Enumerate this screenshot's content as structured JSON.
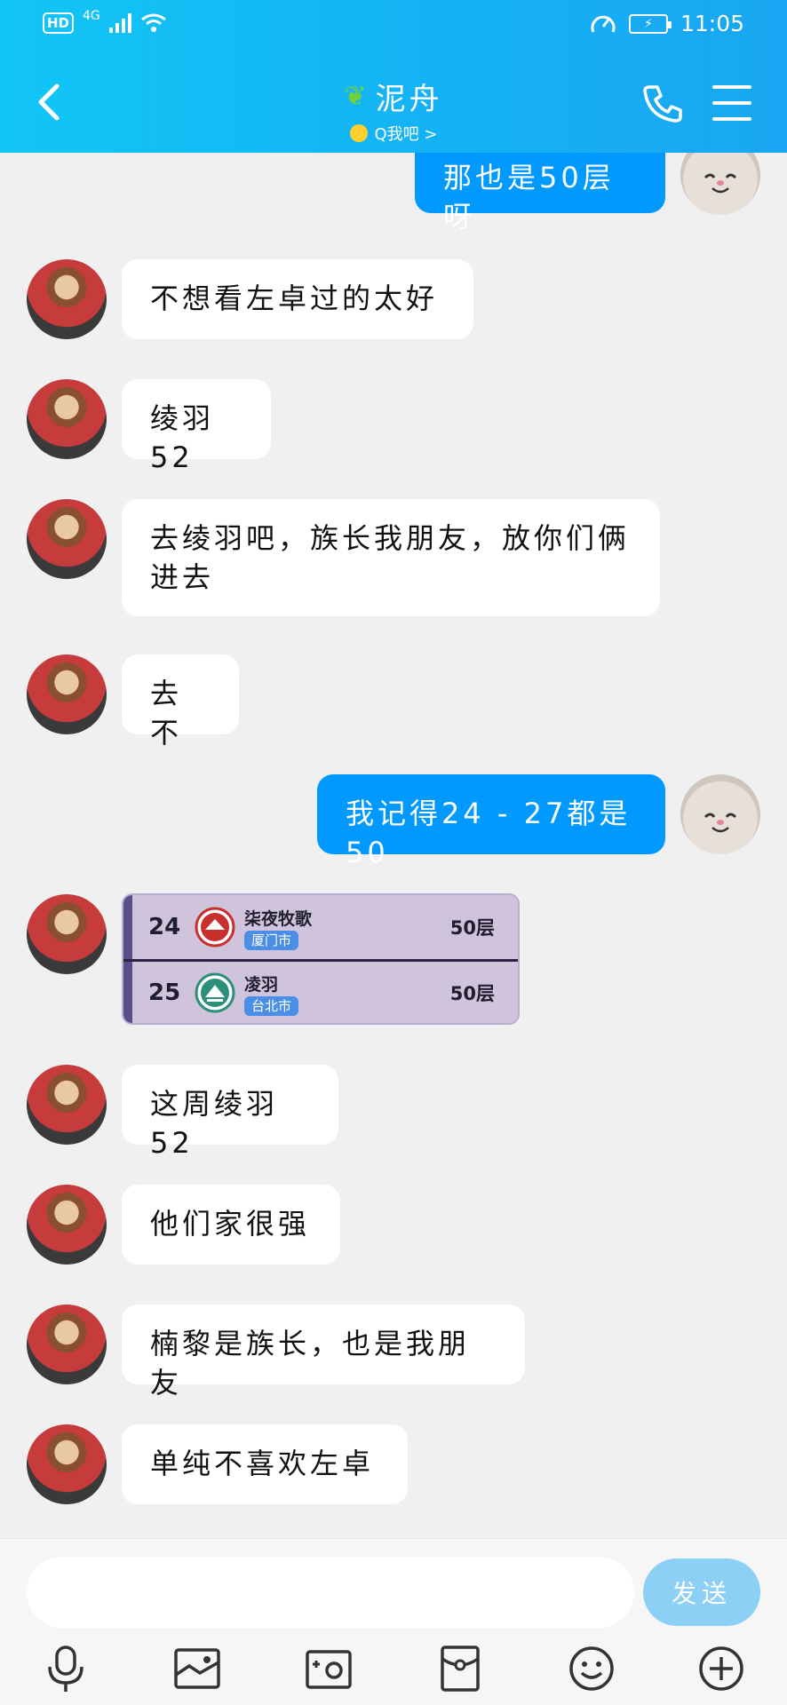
{
  "status_bar": {
    "hd": "HD",
    "network": "4G",
    "time": "11:05"
  },
  "header": {
    "title": "泥舟",
    "subtitle": "Q我吧 >"
  },
  "messages": [
    {
      "side": "out",
      "text": "那也是50层呀"
    },
    {
      "side": "in",
      "text": "不想看左卓过的太好"
    },
    {
      "side": "in",
      "text": "绫羽52"
    },
    {
      "side": "in",
      "text": "去绫羽吧，族长我朋友，放你们俩进去"
    },
    {
      "side": "in",
      "text": "去不"
    },
    {
      "side": "out",
      "text": "我记得24 - 27都是50"
    },
    {
      "side": "in",
      "text": "这周绫羽52"
    },
    {
      "side": "in",
      "text": "他们家很强"
    },
    {
      "side": "in",
      "text": "楠黎是族长，也是我朋友"
    },
    {
      "side": "in",
      "text": "单纯不喜欢左卓"
    }
  ],
  "ranking_card": {
    "rows": [
      {
        "rank": "24",
        "clan": "柒夜牧歌",
        "city": "厦门市",
        "floors": "50层",
        "emblem_color": "#c8302e"
      },
      {
        "rank": "25",
        "clan": "凌羽",
        "city": "台北市",
        "floors": "50层",
        "emblem_color": "#2c8f7a"
      }
    ]
  },
  "input": {
    "placeholder": "",
    "value": ""
  },
  "send_label": "发送",
  "toolbar_icons": [
    "microphone-icon",
    "picture-icon",
    "camera-icon",
    "red-packet-icon",
    "emoji-icon",
    "plus-icon"
  ],
  "colors": {
    "header_start": "#12c6f5",
    "header_end": "#1aa6f2",
    "bubble_out": "#0099ff",
    "send_button": "#8dd0f6"
  }
}
